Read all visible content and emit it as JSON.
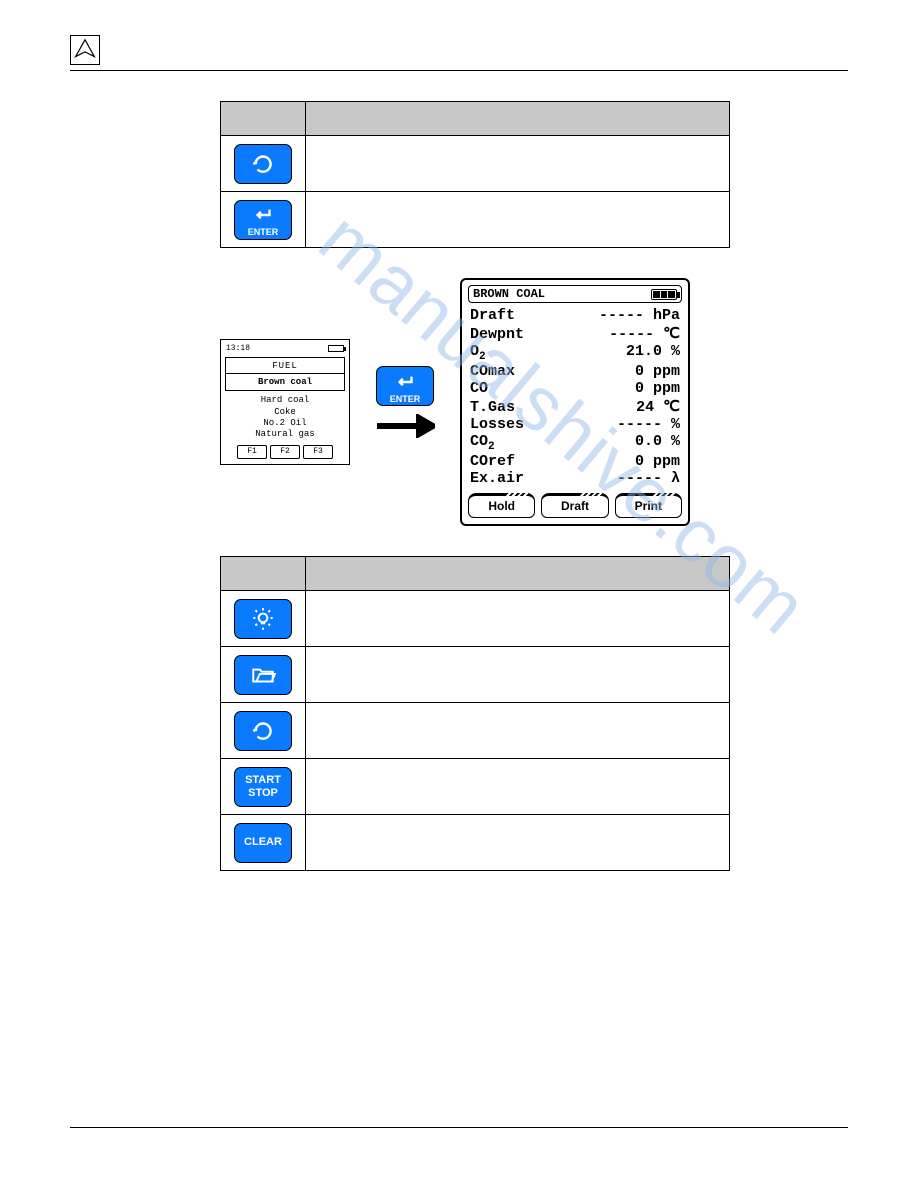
{
  "watermark": "manualshive.com",
  "table1": {
    "rows": [
      "cycle",
      "enter"
    ]
  },
  "small_screen": {
    "time": "13:18",
    "title": "FUEL",
    "selected": "Brown coal",
    "options": [
      "Hard coal",
      "Coke",
      "No.2 Oil",
      "Natural gas"
    ],
    "fkeys": [
      "F1",
      "F2",
      "F3"
    ]
  },
  "big_screen": {
    "title": "BROWN COAL",
    "rows": [
      {
        "label": "Draft",
        "value": "-----",
        "unit": "hPa"
      },
      {
        "label": "Dewpnt",
        "value": "-----",
        "unit": "℃"
      },
      {
        "label": "O",
        "sub": "2",
        "value": "21.0",
        "unit": "%"
      },
      {
        "label": "COmax",
        "value": "0",
        "unit": "ppm"
      },
      {
        "label": "CO",
        "value": "0",
        "unit": "ppm"
      },
      {
        "label": "T.Gas",
        "value": "24",
        "unit": "℃"
      },
      {
        "label": "Losses",
        "value": "-----",
        "unit": "%"
      },
      {
        "label": "CO",
        "sub": "2",
        "value": "0.0",
        "unit": "%"
      },
      {
        "label": "COref",
        "value": "0",
        "unit": "ppm"
      },
      {
        "label": "Ex.air",
        "value": "-----",
        "unit": "λ"
      }
    ],
    "softkeys": [
      "Hold",
      "Draft",
      "Print"
    ]
  },
  "table2": {
    "rows": [
      {
        "type": "light"
      },
      {
        "type": "folder"
      },
      {
        "type": "cycle"
      },
      {
        "type": "startstop",
        "text": "START\nSTOP"
      },
      {
        "type": "clear",
        "text": "CLEAR"
      }
    ]
  }
}
